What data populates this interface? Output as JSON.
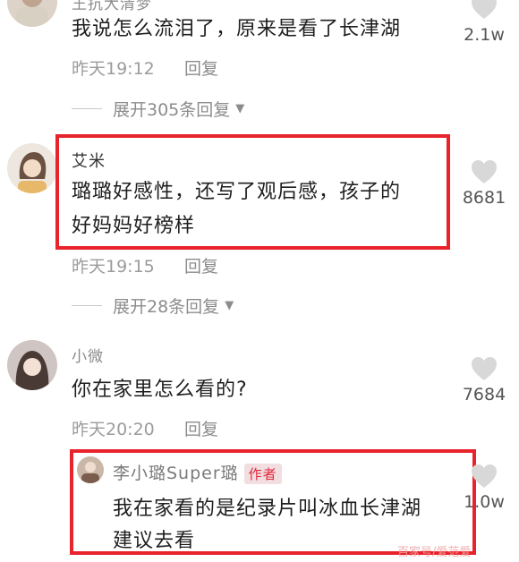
{
  "comments": [
    {
      "username": "王抗大清梦",
      "text": "我说怎么流泪了，原来是看了长津湖",
      "time": "昨天19:12",
      "reply_label": "回复",
      "expand_label": "展开305条回复",
      "likes": "2.1w"
    },
    {
      "username": "艾米",
      "text_line1": "璐璐好感性，还写了观后感，孩子的",
      "text_line2": "好妈妈好榜样",
      "time": "昨天19:15",
      "reply_label": "回复",
      "expand_label": "展开28条回复",
      "likes": "8681"
    },
    {
      "username": "小微",
      "text": "你在家里怎么看的?",
      "time": "昨天20:20",
      "reply_label": "回复",
      "likes": "7684"
    }
  ],
  "author_reply": {
    "username": "李小璐Super璐",
    "badge": "作者",
    "text_line1": "我在家看的是纪录片叫冰血长津湖",
    "text_line2": "建议去看",
    "likes": "1.0w"
  },
  "icons": {
    "like": "heart-icon",
    "expand_caret": "caret-down-icon"
  },
  "colors": {
    "highlight": "#e8232b",
    "badge_text": "#e0283a"
  },
  "watermark": "百家号/爱范爱"
}
